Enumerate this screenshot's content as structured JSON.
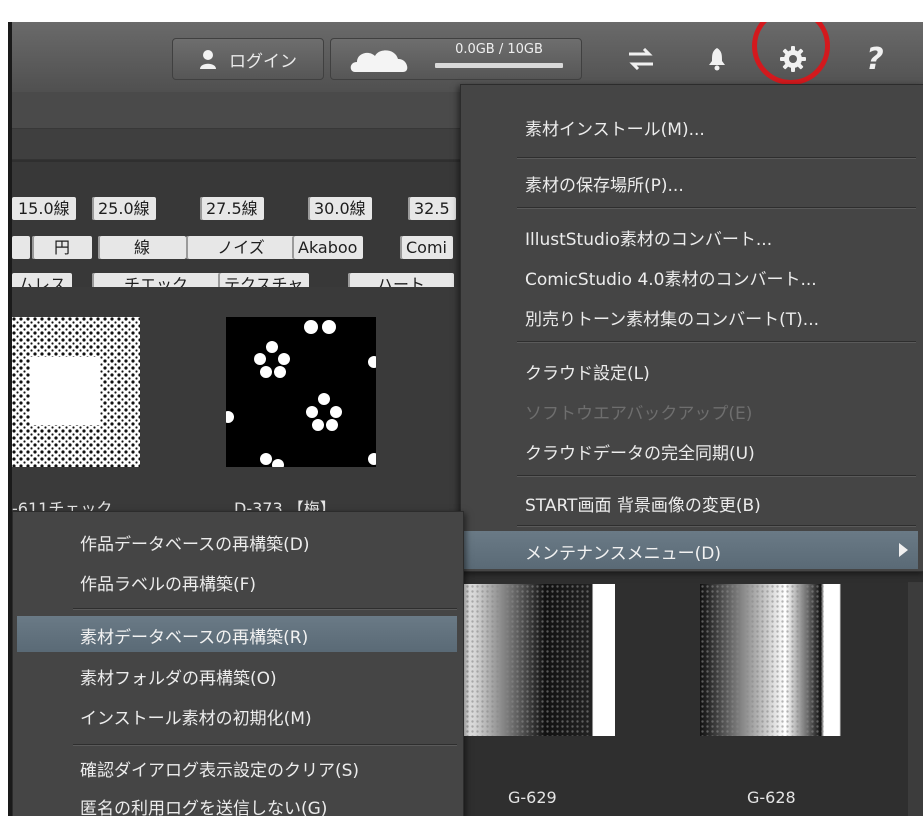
{
  "topbar": {
    "login_label": "ログイン",
    "storage_text": "0.0GB / 10GB",
    "icons": [
      "user-icon",
      "cloud-icon",
      "sync-icon",
      "bell-icon",
      "gear-icon",
      "help-icon"
    ],
    "help_glyph": "?",
    "highlight_color": "#d3191d"
  },
  "filters": {
    "row1": [
      "15.0線",
      "25.0線",
      "27.5線",
      "30.0線",
      "32.5"
    ],
    "row2": [
      "",
      "円",
      "線",
      "ノイズ",
      "Akaboo",
      "Comi"
    ],
    "row3": [
      "ムレス",
      "チエック",
      "テクスチャ",
      "ハート",
      ""
    ]
  },
  "thumbnails": {
    "items": [
      {
        "label": "-611チェック"
      },
      {
        "label": "D-373 【梅】"
      },
      {
        "label": "G-629"
      },
      {
        "label": "G-628"
      }
    ]
  },
  "settings_menu": {
    "items": [
      {
        "label": "素材インストール(M)...",
        "enabled": true
      },
      {
        "label": "素材の保存場所(P)...",
        "enabled": true
      },
      {
        "label": "IllustStudio素材のコンバート...",
        "enabled": true
      },
      {
        "label": "ComicStudio 4.0素材のコンバート...",
        "enabled": true
      },
      {
        "label": "別売りトーン素材集のコンバート(T)...",
        "enabled": true
      },
      {
        "label": "クラウド設定(L)",
        "enabled": true
      },
      {
        "label": "ソフトウエアバックアップ(E)",
        "enabled": false
      },
      {
        "label": "クラウドデータの完全同期(U)",
        "enabled": true
      },
      {
        "label": "START画面 背景画像の変更(B)",
        "enabled": true
      },
      {
        "label": "メンテナンスメニュー(D)",
        "enabled": true,
        "has_submenu": true
      }
    ]
  },
  "maintenance_submenu": {
    "items": [
      {
        "label": "作品データベースの再構築(D)"
      },
      {
        "label": "作品ラベルの再構築(F)"
      },
      {
        "label": "素材データベースの再構築(R)"
      },
      {
        "label": "素材フォルダの再構築(O)"
      },
      {
        "label": "インストール素材の初期化(M)"
      },
      {
        "label": "確認ダイアログ表示設定のクリア(S)"
      },
      {
        "label": "匿名の利用ログを送信しない(G)"
      }
    ]
  }
}
